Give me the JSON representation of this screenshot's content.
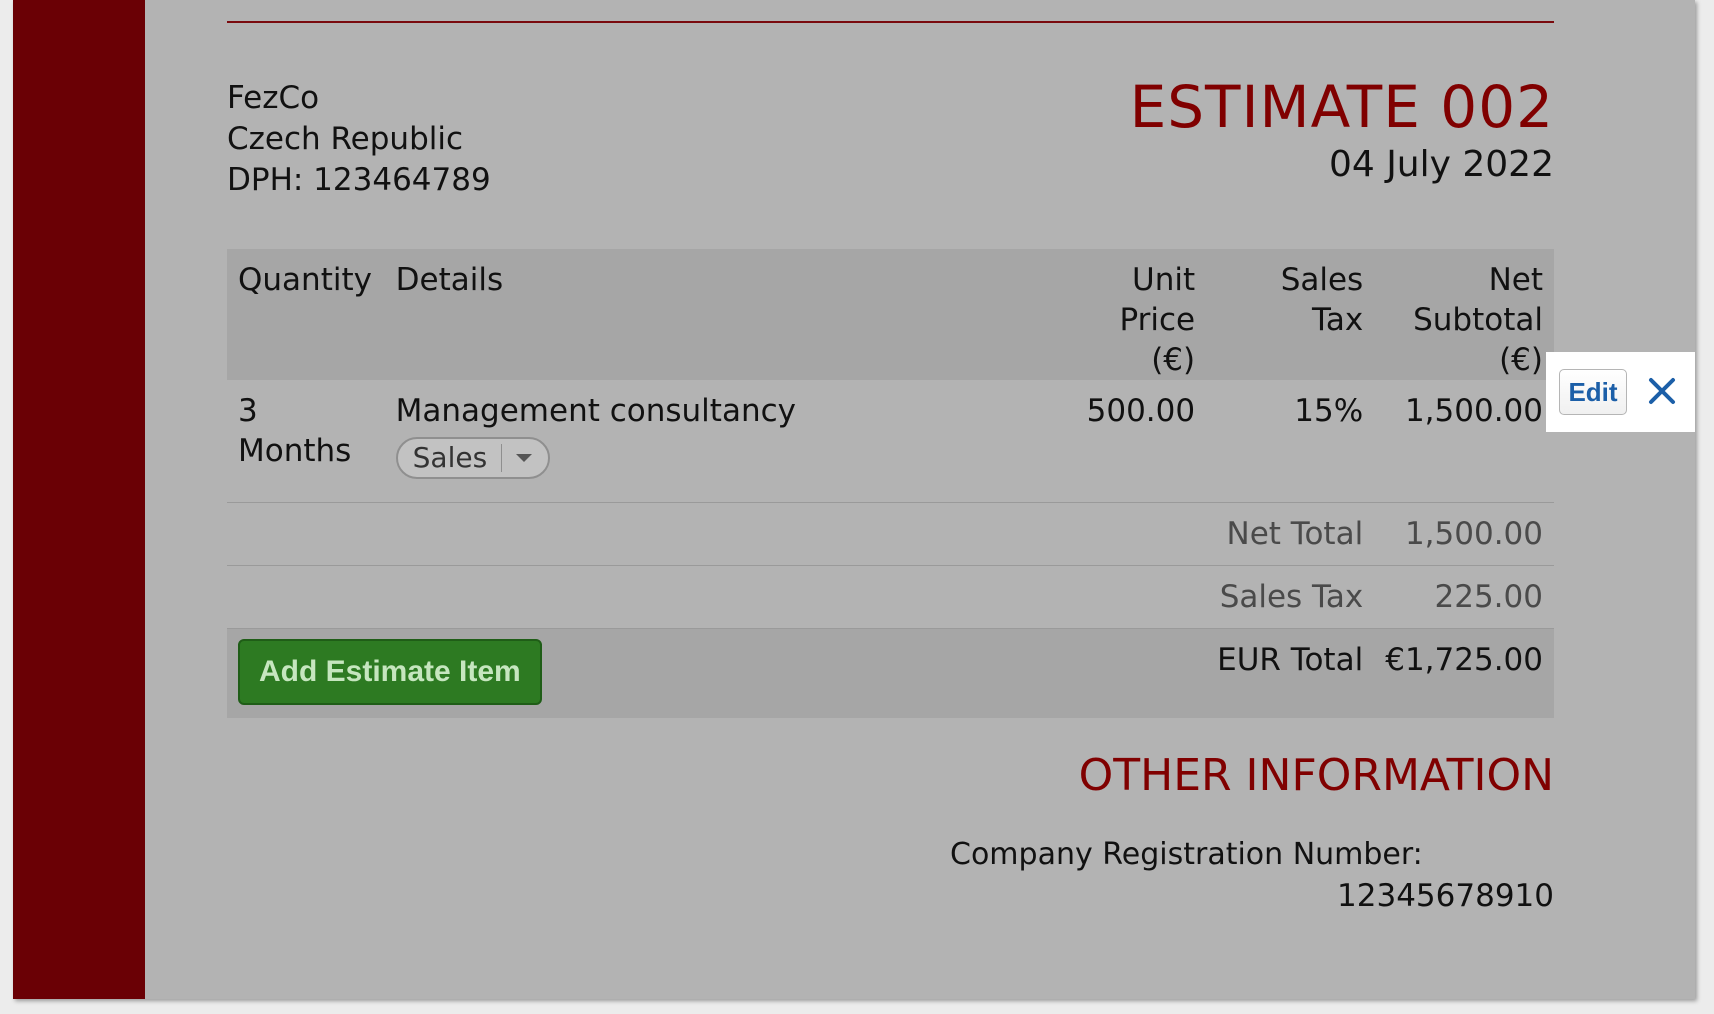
{
  "company": {
    "name": "FezCo",
    "country": "Czech Republic",
    "vat": "DPH: 123464789"
  },
  "estimate": {
    "title": "ESTIMATE 002",
    "date": "04 July 2022"
  },
  "table": {
    "headers": {
      "quantity": "Quantity",
      "details": "Details",
      "unit_price_line1": "Unit Price",
      "unit_price_line2": "(€)",
      "sales_tax_line1": "Sales",
      "sales_tax_line2": "Tax",
      "net_subtotal_line1": "Net Subtotal",
      "net_subtotal_line2": "(€)"
    },
    "rows": [
      {
        "quantity": "3 Months",
        "details": "Management consultancy",
        "category": "Sales",
        "unit_price": "500.00",
        "sales_tax": "15%",
        "net_subtotal": "1,500.00"
      }
    ],
    "net_total_label": "Net Total",
    "net_total_value": "1,500.00",
    "sales_tax_label": "Sales Tax",
    "sales_tax_value": "225.00",
    "eur_total_label": "EUR Total",
    "eur_total_value": "€1,725.00"
  },
  "actions": {
    "add_item": "Add Estimate Item",
    "edit": "Edit",
    "close_icon": "close-icon"
  },
  "other_info": {
    "title": "OTHER INFORMATION",
    "reg_label": "Company Registration Number:",
    "reg_value": "12345678910"
  },
  "colors": {
    "accent": "#800000",
    "stripe": "#6a0005",
    "button_green": "#2d7a22",
    "edit_blue": "#1c5fa8"
  }
}
